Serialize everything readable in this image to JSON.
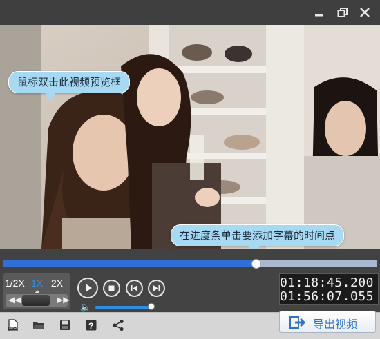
{
  "window": {
    "minimize_icon": "minimize-icon",
    "restore_icon": "restore-icon",
    "close_icon": "close-icon"
  },
  "video": {
    "tooltip_preview": "鼠标双击此视频预览框",
    "tooltip_progress": "在进度条单击要添加字幕的时间点"
  },
  "progress": {
    "played_fraction": 0.675,
    "collapse_icon": "chevron-down-icon"
  },
  "speed": {
    "options": [
      "1/2X",
      "1X",
      "2X"
    ],
    "selected": "1X"
  },
  "playback": {
    "play_icon": "play-icon",
    "stop_icon": "stop-icon",
    "prev_icon": "prev-frame-icon",
    "next_icon": "next-frame-icon",
    "jog_left_icon": "rewind-icon",
    "jog_right_icon": "fast-forward-icon"
  },
  "volume": {
    "icon": "speaker-icon",
    "level_fraction": 0.96
  },
  "timecode": {
    "current": "01:18:45.200",
    "total": "01:56:07.055"
  },
  "toolbar": {
    "new_icon": "new-file-icon",
    "open_icon": "open-folder-icon",
    "save_icon": "save-icon",
    "help_icon": "help-icon",
    "share_icon": "share-icon",
    "export_label": "导出视频"
  },
  "colors": {
    "accent": "#2f6fd6",
    "tooltip": "#a8d9f3",
    "active_speed": "#2f8ee8"
  }
}
